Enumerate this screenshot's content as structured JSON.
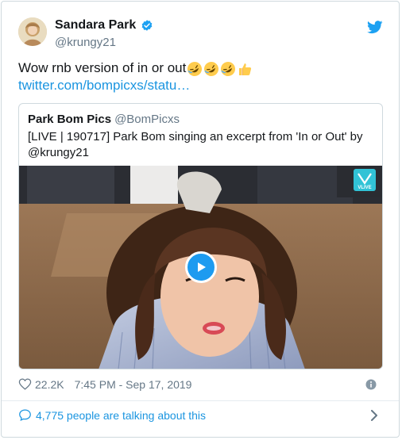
{
  "author": {
    "name": "Sandara Park",
    "handle": "@krungy21"
  },
  "tweet": {
    "text": "Wow rnb version of in or out",
    "emojis": [
      "rolling-on-floor-laughing-emoji",
      "rolling-on-floor-laughing-emoji",
      "rolling-on-floor-laughing-emoji",
      "thumbs-up-emoji"
    ],
    "link": "twitter.com/bompicxs/statu…"
  },
  "quoted": {
    "name": "Park Bom Pics",
    "handle": "@BomPicxs",
    "text": "[LIVE | 190717] Park Bom singing an excerpt from 'In or Out' by @krungy21",
    "media_badge": "VLIVE"
  },
  "meta": {
    "likes": "22.2K",
    "timestamp": "7:45 PM - Sep 17, 2019"
  },
  "footer": {
    "conversation": "4,775 people are talking about this"
  },
  "colors": {
    "accent": "#1b95e0",
    "text": "#14171a",
    "muted": "#657786",
    "border": "#cfd9de"
  }
}
